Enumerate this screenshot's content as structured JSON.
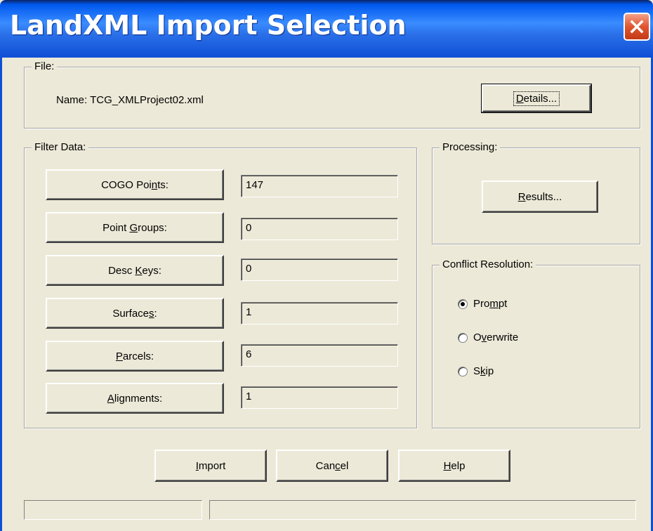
{
  "window": {
    "title": "LandXML Import Selection"
  },
  "file_group": {
    "legend": "File:",
    "name_label": "Name:",
    "name_value": "TCG_XMLProject02.xml",
    "details_button": {
      "pre": "",
      "accel": "D",
      "post": "etails..."
    }
  },
  "filter_group": {
    "legend": "Filter Data:",
    "rows": [
      {
        "btn_pre": "COGO Poi",
        "btn_accel": "n",
        "btn_post": "ts:",
        "value": "147"
      },
      {
        "btn_pre": "Point ",
        "btn_accel": "G",
        "btn_post": "roups:",
        "value": "0"
      },
      {
        "btn_pre": "Desc ",
        "btn_accel": "K",
        "btn_post": "eys:",
        "value": "0"
      },
      {
        "btn_pre": "Surface",
        "btn_accel": "s",
        "btn_post": ":",
        "value": "1"
      },
      {
        "btn_pre": "",
        "btn_accel": "P",
        "btn_post": "arcels:",
        "value": "6"
      },
      {
        "btn_pre": "",
        "btn_accel": "A",
        "btn_post": "lignments:",
        "value": "1"
      }
    ]
  },
  "processing_group": {
    "legend": "Processing:",
    "results_button": {
      "pre": "",
      "accel": "R",
      "post": "esults..."
    }
  },
  "conflict_group": {
    "legend": "Conflict Resolution:",
    "options": [
      {
        "pre": "Pro",
        "accel": "m",
        "post": "pt",
        "checked": true
      },
      {
        "pre": "O",
        "accel": "v",
        "post": "erwrite",
        "checked": false
      },
      {
        "pre": "S",
        "accel": "k",
        "post": "ip",
        "checked": false
      }
    ]
  },
  "footer": {
    "import": {
      "pre": "",
      "accel": "I",
      "post": "mport"
    },
    "cancel": {
      "pre": "Can",
      "accel": "c",
      "post": "el"
    },
    "help": {
      "pre": "",
      "accel": "H",
      "post": "elp"
    }
  },
  "colors": {
    "title_bar": "#0058ee",
    "close_button": "#e0552f",
    "dialog_face": "#ece9d8"
  }
}
